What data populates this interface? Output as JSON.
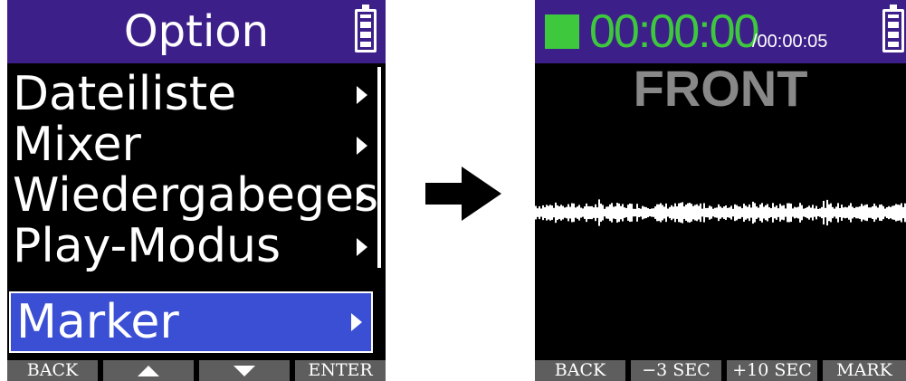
{
  "menu_screen": {
    "title": "Option",
    "items": [
      {
        "label": "Dateiliste",
        "selected": false
      },
      {
        "label": "Mixer",
        "selected": false
      },
      {
        "label": "Wiedergabeges",
        "selected": false
      },
      {
        "label": "Play-Modus",
        "selected": false
      },
      {
        "label": "Marker",
        "selected": true
      }
    ],
    "softkeys": {
      "back": "BACK",
      "up_icon": "triangle-up",
      "down_icon": "triangle-down",
      "enter": "ENTER"
    }
  },
  "playback_screen": {
    "elapsed_time": "00:00:00",
    "total_time": "/00:00:05",
    "channel": "FRONT",
    "softkeys": {
      "back": "BACK",
      "rewind": "−3 SEC",
      "forward": "+10 SEC",
      "mark": "MARK"
    }
  },
  "colors": {
    "header": "#3d1f8a",
    "selection": "#3b4fd4",
    "time_green": "#3ec83e",
    "softkey_gray": "#5e5e5e",
    "channel_gray": "#888888"
  }
}
